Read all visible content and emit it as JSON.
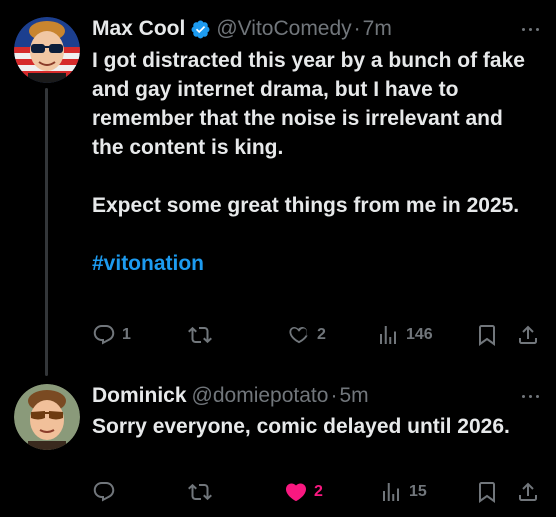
{
  "tweets": [
    {
      "name": "Max Cool",
      "verified": true,
      "handle": "@VitoComedy",
      "separator": "·",
      "time": "7m",
      "paragraphs": [
        "I got distracted this year by a bunch of fake and gay internet drama, but I have to remember that the noise is irrelevant and the content is king.",
        "Expect some great things from me in 2025."
      ],
      "hashtag": "#vitonation",
      "actions": {
        "replies": "1",
        "reposts": "",
        "likes": "2",
        "views": "146"
      },
      "liked": false
    },
    {
      "name": "Dominick",
      "verified": false,
      "handle": "@domiepotato",
      "separator": "·",
      "time": "5m",
      "paragraphs": [
        "Sorry everyone, comic delayed until 2026."
      ],
      "actions": {
        "replies": "",
        "reposts": "",
        "likes": "2",
        "views": "15"
      },
      "liked": true
    }
  ],
  "colors": {
    "background": "#000000",
    "text": "#e7e9ea",
    "muted": "#71767b",
    "link": "#1d9bf0",
    "like": "#f91880",
    "verified": "#1d9bf0"
  }
}
